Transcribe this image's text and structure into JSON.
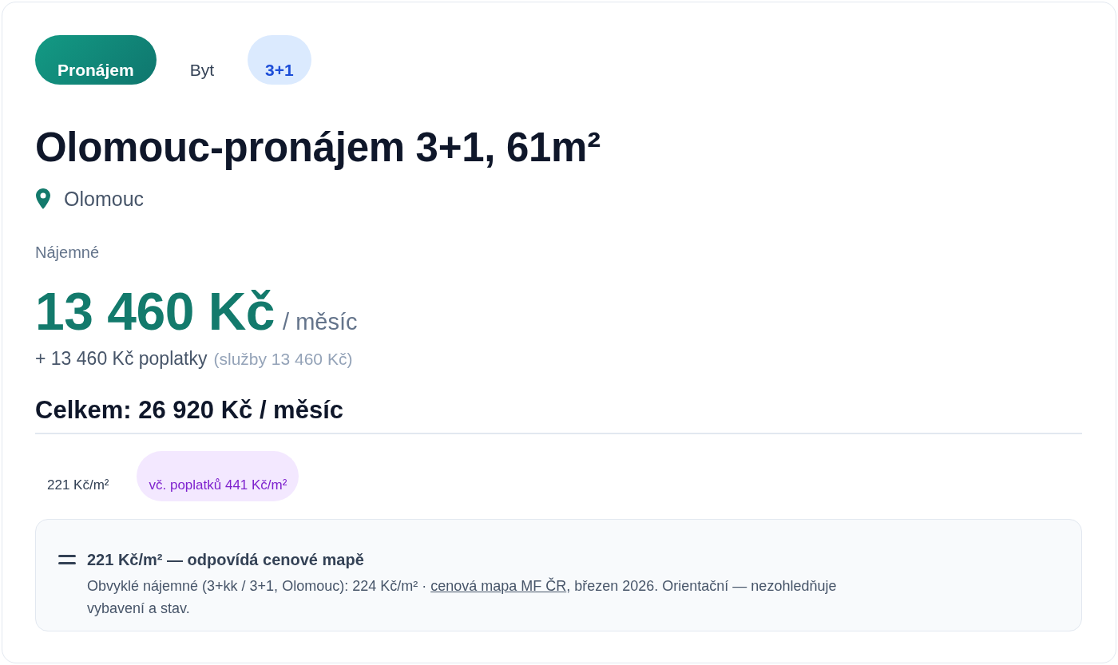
{
  "tags": [
    {
      "label": "Pronájem",
      "kind": "offer"
    },
    {
      "label": "Byt",
      "kind": "plain"
    },
    {
      "label": "3+1",
      "kind": "layout"
    }
  ],
  "title": "Olomouc-pronájem 3+1, 61m²",
  "location": "Olomouc",
  "rent": {
    "label": "Nájemné",
    "amount": "13 460 Kč",
    "period": "/ měsíc",
    "fees": "+ 13 460 Kč poplatky",
    "fees_note": "(služby 13 460 Kč)",
    "total": "Celkem: 26 920 Kč / měsíc"
  },
  "unit_prices": [
    {
      "label": "221 Kč/m²",
      "kind": "plain"
    },
    {
      "label": "vč. poplatků 441 Kč/m²",
      "kind": "highlight"
    }
  ],
  "price_map": {
    "kind": "match",
    "heading": "221 Kč/m² — odpovídá cenové mapě",
    "text_before": "Obvyklé nájemné (3+kk / 3+1, Olomouc): 224 Kč/m² · ",
    "link": "cenová mapa MF ČR",
    "text_after": ", březen 2026. Orientační — nezohledňuje vybavení a stav."
  }
}
